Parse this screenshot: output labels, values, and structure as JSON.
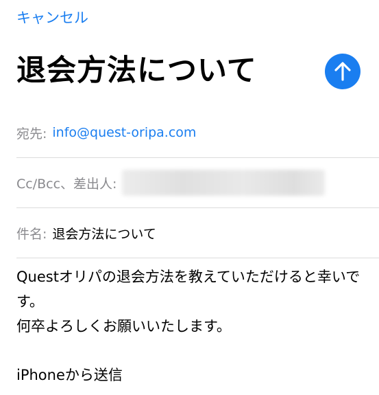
{
  "header": {
    "cancel_label": "キャンセル",
    "title": "退会方法について",
    "send_icon": "arrow-up-icon",
    "accent_color": "#1a7ef0"
  },
  "fields": {
    "to_label": "宛先:",
    "to_value": "info@quest-oripa.com",
    "cc_label": "Cc/Bcc、差出人:",
    "subject_label": "件名:",
    "subject_value": "退会方法について"
  },
  "body": {
    "text": "Questオリパの退会方法を教えていただけると幸いです。\n何卒よろしくお願いいたします。",
    "signature": "iPhoneから送信"
  }
}
